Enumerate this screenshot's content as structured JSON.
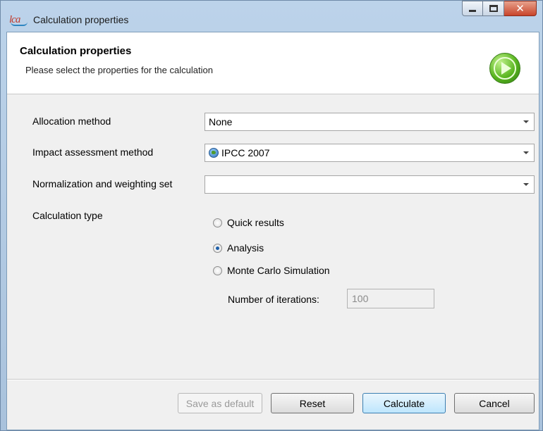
{
  "window": {
    "title": "Calculation properties",
    "app_logo_text": "lca"
  },
  "header": {
    "title": "Calculation properties",
    "subtitle": "Please select the properties for the calculation"
  },
  "form": {
    "allocation": {
      "label": "Allocation method",
      "value": "None"
    },
    "impact": {
      "label": "Impact assessment method",
      "value": "IPCC 2007"
    },
    "normalization": {
      "label": "Normalization and weighting set",
      "value": ""
    },
    "calc_type": {
      "label": "Calculation type",
      "options": [
        {
          "label": "Quick results",
          "checked": false
        },
        {
          "label": "Analysis",
          "checked": true
        },
        {
          "label": "Monte Carlo Simulation",
          "checked": false
        }
      ]
    },
    "iterations": {
      "label": "Number of iterations:",
      "value": "100"
    }
  },
  "buttons": {
    "save_default": "Save as default",
    "reset": "Reset",
    "calculate": "Calculate",
    "cancel": "Cancel"
  },
  "icons": {
    "window_minimize": "minimize-icon",
    "window_maximize": "maximize-icon",
    "window_close": "close-icon",
    "play": "play-icon",
    "globe": "globe-icon"
  }
}
